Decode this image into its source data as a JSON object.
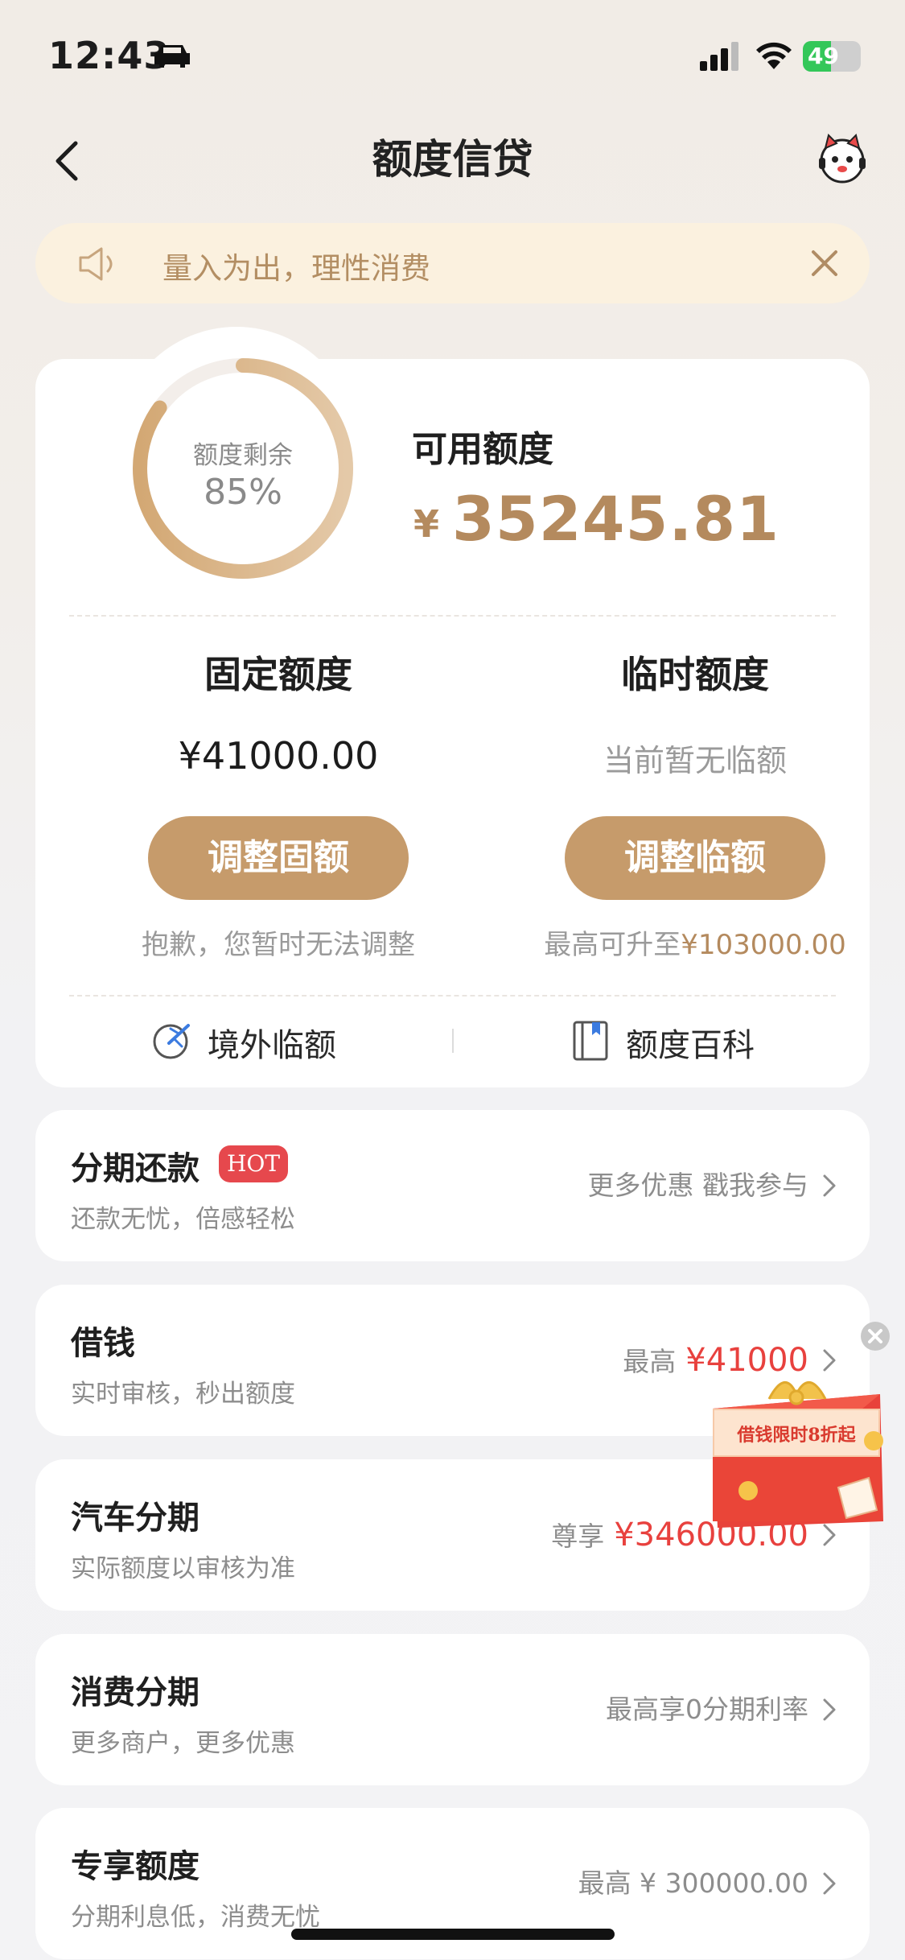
{
  "status_bar": {
    "time": "12:43",
    "battery": "49",
    "battery_level": 0.49
  },
  "nav": {
    "title": "额度信贷"
  },
  "notice": {
    "text": "量入为出，理性消费"
  },
  "credit": {
    "ring_label": "额度剩余",
    "ring_value": "85%",
    "remaining_fraction": 0.85,
    "available_label": "可用额度",
    "available_currency": "¥",
    "available_amount": "35245.81",
    "fixed": {
      "title": "固定额度",
      "value": "¥41000.00",
      "button": "调整固额",
      "hint": "抱歉，您暂时无法调整"
    },
    "temporary": {
      "title": "临时额度",
      "value": "当前暂无临额",
      "button": "调整临额",
      "hint_prefix": "最高可升至",
      "hint_amount": "¥103000.00"
    },
    "links": {
      "overseas": "境外临额",
      "wiki": "额度百科"
    }
  },
  "items": [
    {
      "title": "分期还款",
      "badge": "HOT",
      "subtitle": "还款无忧，倍感轻松",
      "right": "更多优惠 戳我参与",
      "highlight": ""
    },
    {
      "title": "借钱",
      "subtitle": "实时审核，秒出额度",
      "right": "最高",
      "highlight": "¥41000"
    },
    {
      "title": "汽车分期",
      "subtitle": "实际额度以审核为准",
      "right": "尊享",
      "highlight": "¥346000.00"
    },
    {
      "title": "消费分期",
      "subtitle": "更多商户，更多优惠",
      "right": "最高享0分期利率",
      "highlight": ""
    },
    {
      "title": "专享额度",
      "subtitle": "分期利息低，消费无忧",
      "right": "最高 ¥ 300000.00",
      "highlight": ""
    }
  ],
  "promo": {
    "text": "借钱限时8折起"
  },
  "colors": {
    "accent": "#c69b6b",
    "accent_text": "#b48a5e",
    "red": "#e8413e",
    "notice_bg": "#fbf1df"
  }
}
